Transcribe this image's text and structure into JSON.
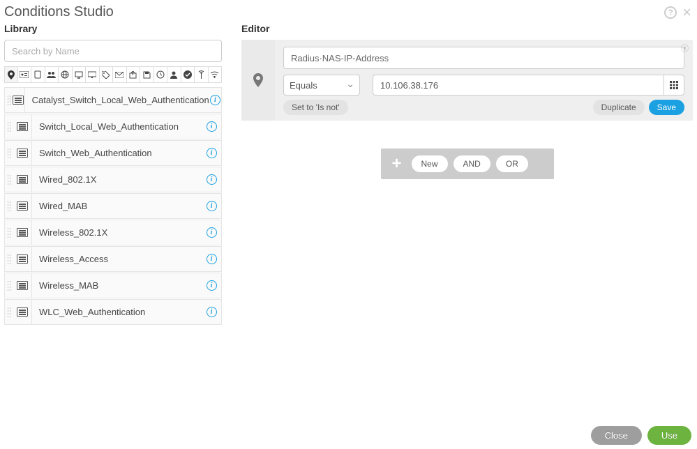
{
  "header": {
    "title": "Conditions Studio"
  },
  "library": {
    "title": "Library",
    "search_placeholder": "Search by Name",
    "items": [
      {
        "label": "Catalyst_Switch_Local_Web_Authentication"
      },
      {
        "label": "Switch_Local_Web_Authentication"
      },
      {
        "label": "Switch_Web_Authentication"
      },
      {
        "label": "Wired_802.1X"
      },
      {
        "label": "Wired_MAB"
      },
      {
        "label": "Wireless_802.1X"
      },
      {
        "label": "Wireless_Access"
      },
      {
        "label": "Wireless_MAB"
      },
      {
        "label": "WLC_Web_Authentication"
      }
    ]
  },
  "editor": {
    "title": "Editor",
    "dictionary": "Radius·NAS-IP-Address",
    "operator": "Equals",
    "value": "10.106.38.176",
    "set_not_label": "Set to 'Is not'",
    "duplicate_label": "Duplicate",
    "save_label": "Save",
    "logic": {
      "new": "New",
      "and": "AND",
      "or": "OR"
    }
  },
  "footer": {
    "close": "Close",
    "use": "Use"
  }
}
